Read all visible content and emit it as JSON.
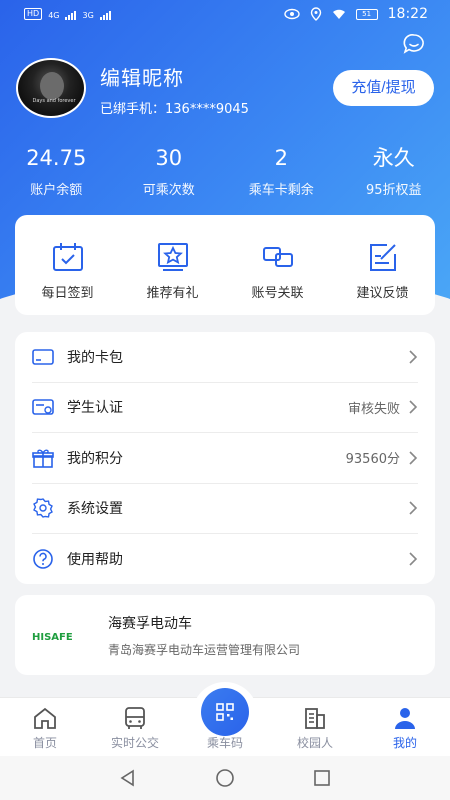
{
  "status_bar": {
    "left_badge": "HD",
    "net1": "4G",
    "net2": "3G",
    "battery": "51",
    "time": "18:22"
  },
  "profile": {
    "nickname": "编辑昵称",
    "phone_label": "已绑手机：136****9045",
    "avatar_caption": "Days and forever",
    "recharge_label": "充值/提现"
  },
  "stats": [
    {
      "value": "24.75",
      "label": "账户余额"
    },
    {
      "value": "30",
      "label": "可乘次数"
    },
    {
      "value": "2",
      "label": "乘车卡剩余"
    },
    {
      "value": "永久",
      "label": "95折权益"
    }
  ],
  "quick_actions": [
    {
      "label": "每日签到",
      "icon": "calendar-check-icon"
    },
    {
      "label": "推荐有礼",
      "icon": "star-badge-icon"
    },
    {
      "label": "账号关联",
      "icon": "link-icon"
    },
    {
      "label": "建议反馈",
      "icon": "edit-note-icon"
    }
  ],
  "menu": [
    {
      "label": "我的卡包",
      "value": "",
      "icon": "card-icon"
    },
    {
      "label": "学生认证",
      "value": "审核失败",
      "icon": "id-card-icon"
    },
    {
      "label": "我的积分",
      "value": "93560分",
      "icon": "gift-icon"
    },
    {
      "label": "系统设置",
      "value": "",
      "icon": "gear-icon"
    },
    {
      "label": "使用帮助",
      "value": "",
      "icon": "help-icon"
    }
  ],
  "company": {
    "logo_text": "HISAFE",
    "name": "海赛孚电动车",
    "subtitle": "青岛海赛孚电动车运营管理有限公司"
  },
  "tabs": [
    {
      "label": "首页",
      "icon": "home-icon"
    },
    {
      "label": "实时公交",
      "icon": "bus-icon"
    },
    {
      "label": "乘车码",
      "icon": "qr-icon"
    },
    {
      "label": "校园人",
      "icon": "building-icon"
    },
    {
      "label": "我的",
      "icon": "person-icon",
      "active": true
    }
  ],
  "colors": {
    "accent": "#2a63ea",
    "logo_green": "#1f9e3f"
  }
}
